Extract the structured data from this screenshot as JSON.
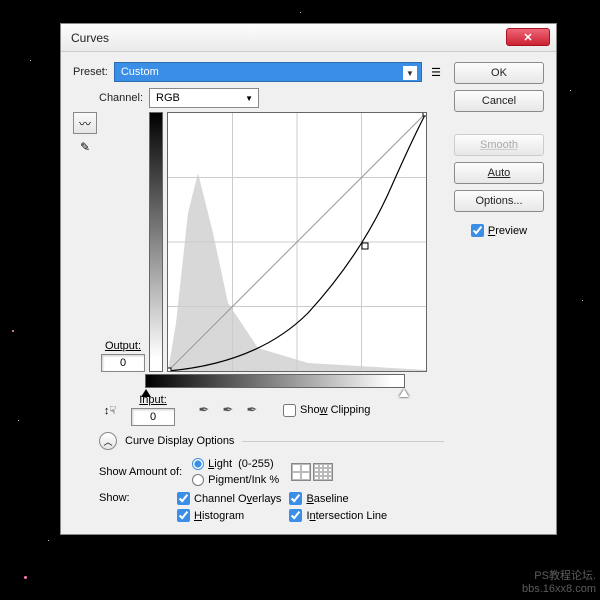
{
  "dialog": {
    "title": "Curves"
  },
  "preset": {
    "label": "Preset:",
    "value": "Custom"
  },
  "buttons": {
    "ok": "OK",
    "cancel": "Cancel",
    "smooth": "Smooth",
    "auto": "Auto",
    "options": "Options..."
  },
  "preview": {
    "label": "Preview"
  },
  "channel": {
    "label": "Channel:",
    "value": "RGB"
  },
  "output": {
    "label": "Output:",
    "value": "0"
  },
  "input": {
    "label": "Input:",
    "value": "0"
  },
  "show_clipping": "Show Clipping",
  "curve_display": "Curve Display Options",
  "show_amount": {
    "label": "Show Amount of:",
    "light": "Light  (0-255)",
    "pigment": "Pigment/Ink %"
  },
  "show": {
    "label": "Show:",
    "channel_overlays": "Channel Overlays",
    "histogram": "Histogram",
    "baseline": "Baseline",
    "intersection": "Intersection Line"
  },
  "watermark": {
    "line1": "PS教程论坛.",
    "line2": "bbs.16xx8.com"
  },
  "chart_data": {
    "type": "curve",
    "title": "Curves",
    "xlabel": "Input",
    "ylabel": "Output",
    "xlim": [
      0,
      255
    ],
    "ylim": [
      0,
      255
    ],
    "baseline": [
      [
        0,
        0
      ],
      [
        255,
        255
      ]
    ],
    "curve_points": [
      [
        0,
        0
      ],
      [
        64,
        16
      ],
      [
        128,
        48
      ],
      [
        195,
        125
      ],
      [
        230,
        195
      ],
      [
        255,
        255
      ]
    ],
    "control_points": [
      [
        0,
        0
      ],
      [
        195,
        125
      ],
      [
        255,
        255
      ]
    ]
  }
}
